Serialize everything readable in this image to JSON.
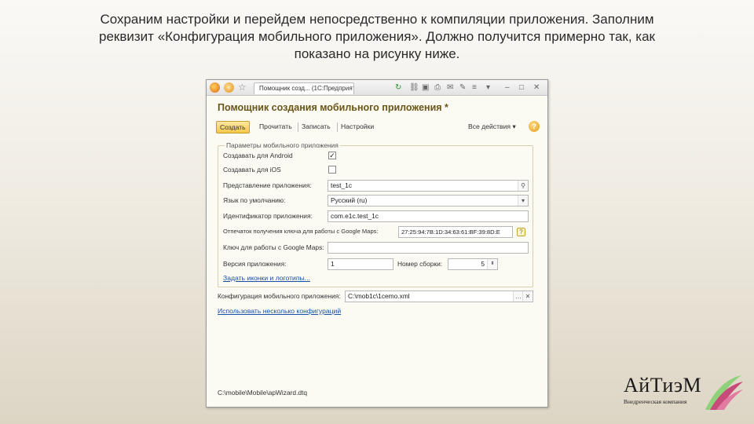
{
  "caption": {
    "line1": "Сохраним настройки и перейдем непосредственно к компиляции приложения. Заполним",
    "line2": "реквизит «Конфигурация мобильного приложения». Должно получится примерно так, как",
    "line3": "показано на рисунку ниже."
  },
  "window": {
    "tab_title": "Помощник созд... (1С:Предприятие)",
    "heading": "Помощник создания мобильного приложения *",
    "toolbar": {
      "create": "Создать",
      "read": "Прочитать",
      "write": "Записать",
      "settings": "Настройки",
      "all_actions": "Все действия",
      "help": "?"
    },
    "group": {
      "title": "Параметры мобильного приложения",
      "android_label": "Создавать для Android",
      "android_checked": true,
      "ios_label": "Создавать для iOS",
      "ios_checked": false,
      "name_label": "Представление приложения:",
      "name_value": "test_1c",
      "lang_label": "Язык по умолчанию:",
      "lang_value": "Русский (ru)",
      "id_label": "Идентификатор приложения:",
      "id_value": "com.e1c.test_1c",
      "fingerprint_label": "Отпечаток получения ключа для работы с Google Maps:",
      "fingerprint_value": "27:25:94:7B:1D:34:63:61:BF:39:8D:E",
      "mapskey_label": "Ключ для работы с Google Maps:",
      "mapskey_value": "",
      "version_label": "Версия приложения:",
      "version_value": "1",
      "build_label": "Номер сборки:",
      "build_value": "5",
      "icons_link": "Задать иконки и логотипы..."
    },
    "config_label": "Конфигурация мобильного приложения:",
    "config_value": "C:\\mob1c\\1cemo.xml",
    "multi_config_link": "Использовать несколько конфигураций",
    "path": "C:\\mobile\\Mobile\\apWizard.dtq"
  },
  "brand": {
    "name": "АйТиэМ",
    "subtitle": "Внедренческая компания"
  },
  "colors": {
    "heading": "#6b5418",
    "link": "#1a4fa6",
    "primary_button": "#f3c74a"
  }
}
